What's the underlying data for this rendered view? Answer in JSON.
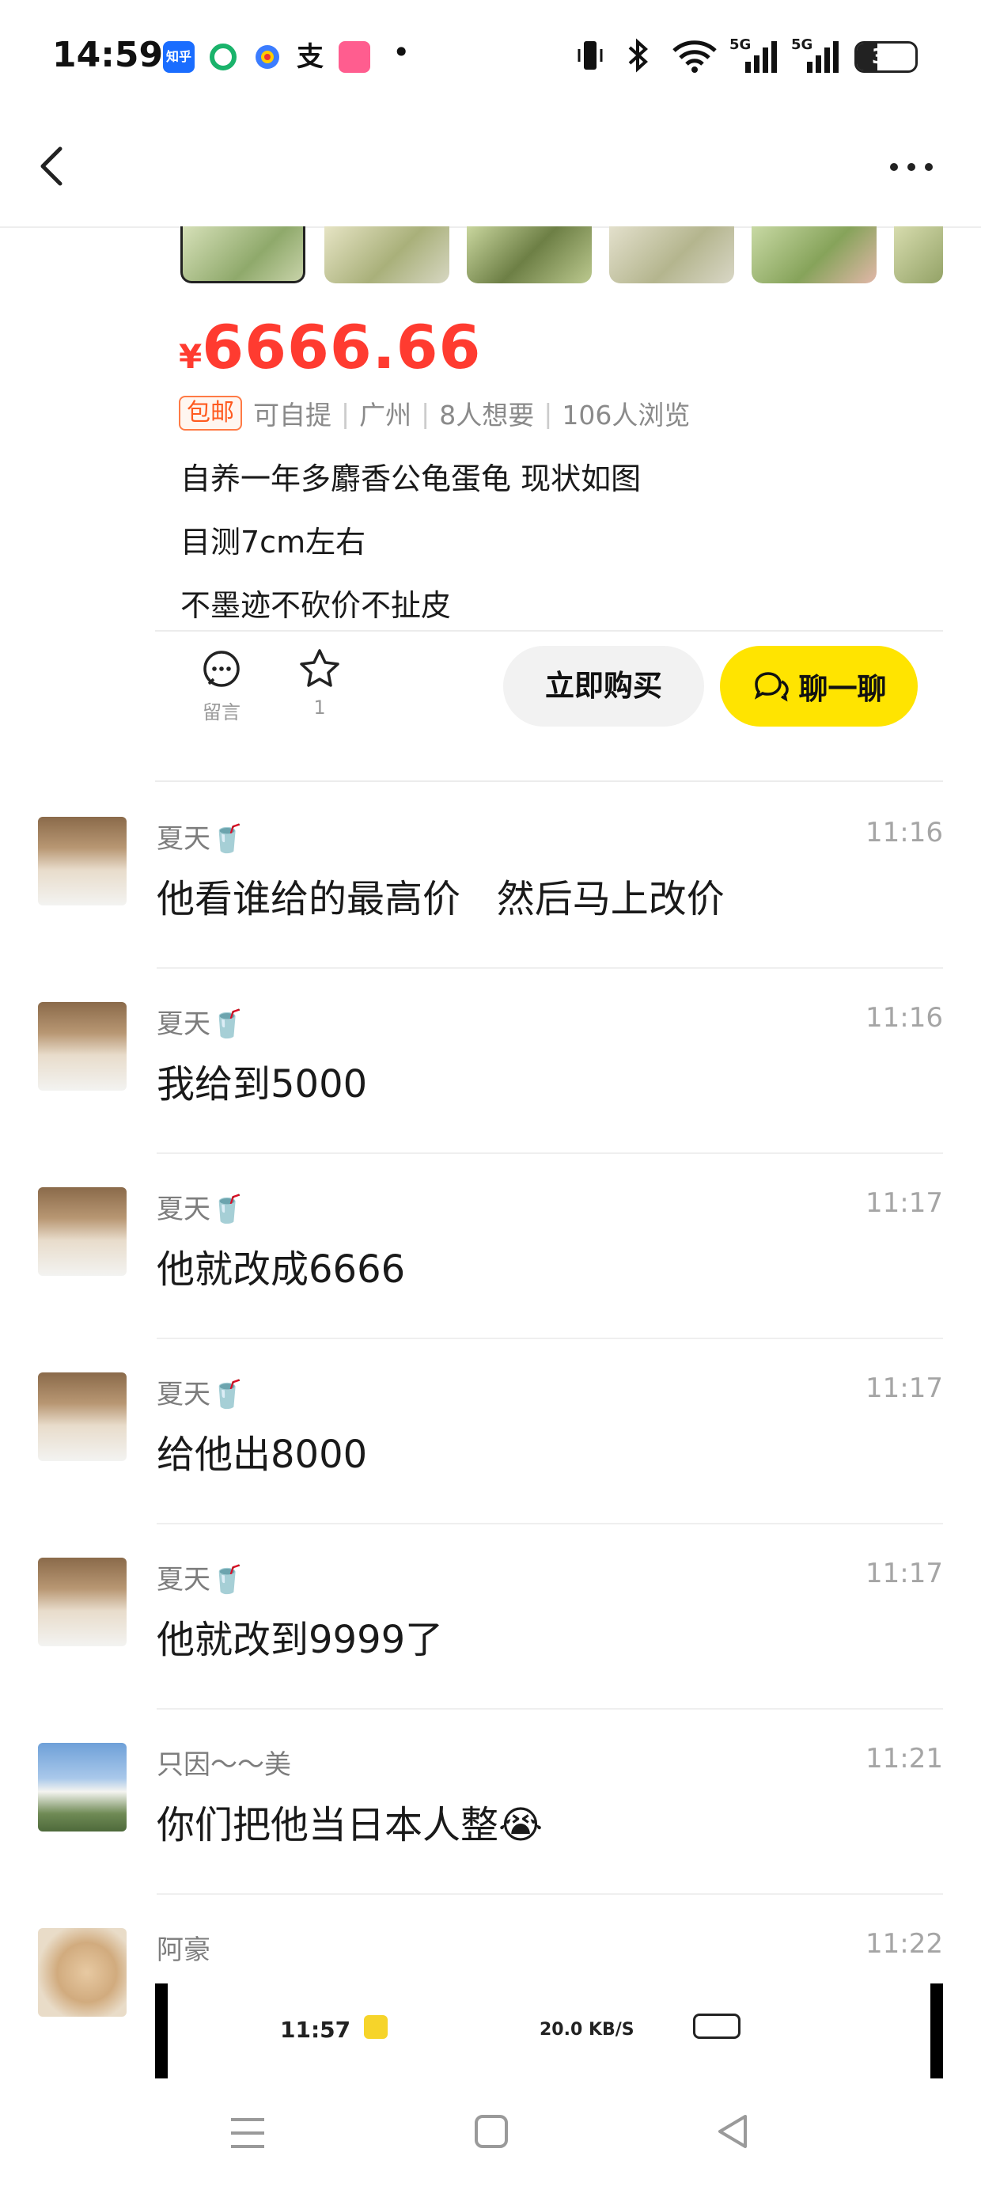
{
  "status_bar": {
    "time": "14:59",
    "apps": [
      "知乎",
      "",
      "",
      "支",
      "",
      "•"
    ],
    "network_label_1": "5G",
    "network_label_2": "5G",
    "battery": "35",
    "battery_level": 0.35
  },
  "nav": {
    "back_icon": "chevron-left-icon",
    "more_icon": "more-horizontal-icon"
  },
  "product": {
    "currency": "¥",
    "price": "6666.66",
    "badge": "包邮",
    "meta": [
      "可自提",
      "广州",
      "8人想要",
      "106人浏览"
    ],
    "description": [
      "自养一年多麝香公龟蛋龟 现状如图",
      "目测7cm左右",
      "不墨迹不砍价不扯皮"
    ]
  },
  "actions": {
    "comment_label": "留言",
    "favorite_count": "1",
    "buy_label": "立即购买",
    "chat_label": "聊一聊"
  },
  "comments": [
    {
      "name": "夏天🥤",
      "time": "11:16",
      "text": "他看谁给的最高价   然后马上改价"
    },
    {
      "name": "夏天🥤",
      "time": "11:16",
      "text": "我给到5000"
    },
    {
      "name": "夏天🥤",
      "time": "11:17",
      "text": "他就改成6666"
    },
    {
      "name": "夏天🥤",
      "time": "11:17",
      "text": "给他出8000"
    },
    {
      "name": "夏天🥤",
      "time": "11:17",
      "text": "他就改到9999了"
    },
    {
      "name": "只因～～美",
      "time": "11:21",
      "text": "你们把他当日本人整😭"
    },
    {
      "name": "阿豪",
      "time": "11:22",
      "text": ""
    }
  ],
  "overlay_strip": {
    "time": "11:57",
    "status": "20.0 KB/S"
  },
  "colors": {
    "price_red": "#ff3b30",
    "chat_yellow": "#ffe400",
    "badge_orange": "#ff5a1f"
  }
}
